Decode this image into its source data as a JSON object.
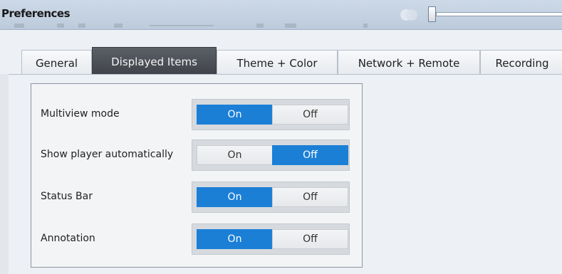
{
  "window": {
    "title": "Preferences"
  },
  "tabs": [
    {
      "label": "General",
      "active": false
    },
    {
      "label": "Displayed Items",
      "active": true
    },
    {
      "label": "Theme + Color",
      "active": false
    },
    {
      "label": "Network + Remote",
      "active": false
    },
    {
      "label": "Recording",
      "active": false
    }
  ],
  "settings": [
    {
      "label": "Multiview mode",
      "on_label": "On",
      "off_label": "Off",
      "value": "On"
    },
    {
      "label": "Show player automatically",
      "on_label": "On",
      "off_label": "Off",
      "value": "Off"
    },
    {
      "label": "Status Bar",
      "on_label": "On",
      "off_label": "Off",
      "value": "On"
    },
    {
      "label": "Annotation",
      "on_label": "On",
      "off_label": "Off",
      "value": "On"
    }
  ],
  "colors": {
    "accent": "#1b7fd6",
    "active_tab": "#4a4e55",
    "titlebar": "#c4d2e2"
  },
  "slider": {
    "value": 0
  }
}
